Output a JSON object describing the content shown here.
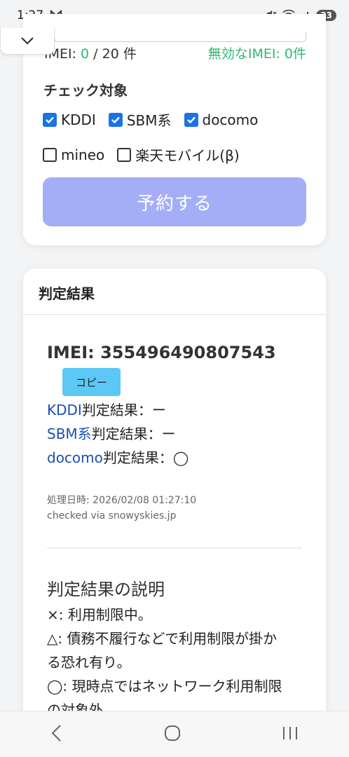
{
  "status": {
    "time": "1:27",
    "mail_icon": "gmail-icon",
    "battery": "33"
  },
  "form": {
    "imei_label": "IMEI: ",
    "imei_count": "0",
    "imei_total": " / 20 件",
    "invalid": "無効なIMEI: 0件",
    "check_heading": "チェック対象",
    "carriers": [
      {
        "label": "KDDI",
        "checked": true
      },
      {
        "label": "SBM系",
        "checked": true
      },
      {
        "label": "docomo",
        "checked": true
      },
      {
        "label": "mineo",
        "checked": false
      },
      {
        "label": "楽天モバイル(β)",
        "checked": false
      }
    ],
    "reserve_button": "予約する",
    "accent_color": "#a4aef7",
    "green_color": "#2eb872"
  },
  "result": {
    "header": "判定結果",
    "imei": "IMEI: 355496490807543",
    "copy_button": "コピー",
    "lines": [
      {
        "carrier": "KDDI",
        "suffix": "判定結果：ー"
      },
      {
        "carrier": "SBM系",
        "suffix": "判定結果：ー"
      },
      {
        "carrier": "docomo",
        "suffix": "判定結果：◯"
      }
    ],
    "processed_at": "処理日時: 2026/02/08 01:27:10",
    "checked_via": "checked via snowyskies.jp",
    "explain_title": "判定結果の説明",
    "explain": [
      "×: 利用制限中。",
      "△: 債務不履行などで利用制限が掛か",
      "る恐れ有り。",
      "◯: 現時点ではネットワーク利用制限",
      "の対象外。"
    ]
  }
}
